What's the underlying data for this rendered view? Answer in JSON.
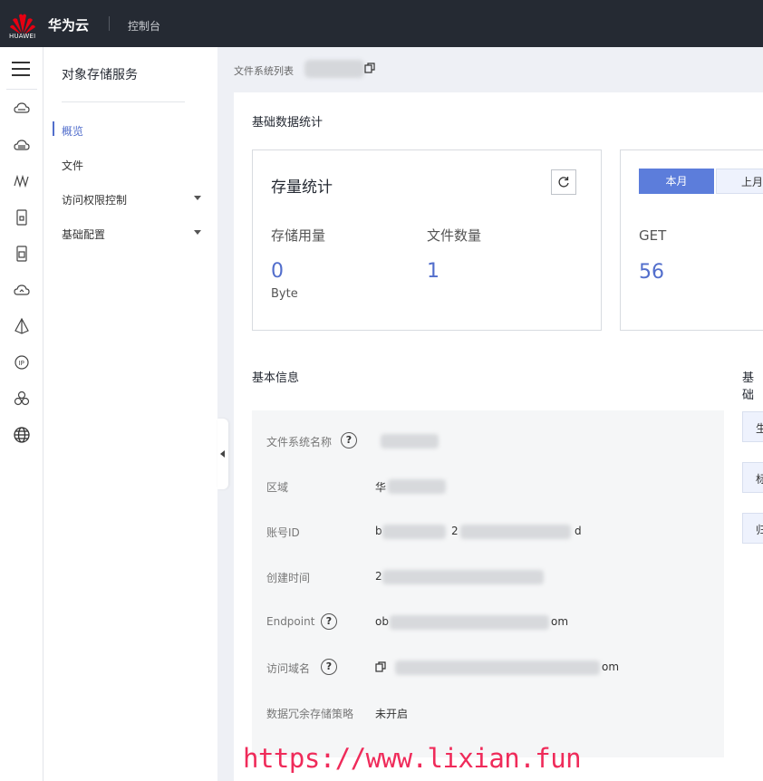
{
  "topbar": {
    "logo_text": "HUAWEI",
    "brand": "华为云",
    "console": "控制台"
  },
  "rail": {
    "icons": [
      "cloud-server-icon",
      "disk-icon",
      "network-icon",
      "storage-icon",
      "file-icon",
      "cloud-icon",
      "pyramid-icon",
      "ip-icon",
      "cluster-icon",
      "cdn-globe-icon"
    ]
  },
  "subnav": {
    "title": "对象存储服务",
    "items": [
      {
        "label": "概览",
        "active": true
      },
      {
        "label": "文件",
        "active": false
      },
      {
        "label": "访问权限控制",
        "active": false
      },
      {
        "label": "基础配置",
        "active": false
      }
    ]
  },
  "breadcrumb": {
    "label": "文件系统列表"
  },
  "main": {
    "stats_section_title": "基础数据统计",
    "storage_card": {
      "title": "存量统计",
      "usage_label": "存储用量",
      "usage_value": "0",
      "usage_unit": "Byte",
      "files_label": "文件数量",
      "files_value": "1"
    },
    "request_card": {
      "tab_current": "本月",
      "tab_previous": "上月",
      "metric_label": "GET",
      "metric_value": "56"
    },
    "info_section_title": "基本信息",
    "info_section_title_right": "基础",
    "info": {
      "fs_name_label": "文件系统名称",
      "region_label": "区域",
      "region_value_prefix": "华",
      "account_label": "账号ID",
      "account_value_start": "b",
      "account_value_mid": "2",
      "account_value_end": "d",
      "created_label": "创建时间",
      "created_value_start": "2",
      "endpoint_label": "Endpoint",
      "endpoint_value_start": "ob",
      "endpoint_value_end": "om",
      "domain_label": "访问域名",
      "domain_value_end": "om",
      "redundancy_label": "数据冗余存储策略",
      "redundancy_value": "未开启"
    },
    "side_buttons": [
      "生",
      "标",
      "归"
    ]
  },
  "watermark": "https://www.lixian.fun",
  "colors": {
    "accent": "#526ecc",
    "topbar": "#252a33",
    "watermark": "#ef2b5a"
  }
}
